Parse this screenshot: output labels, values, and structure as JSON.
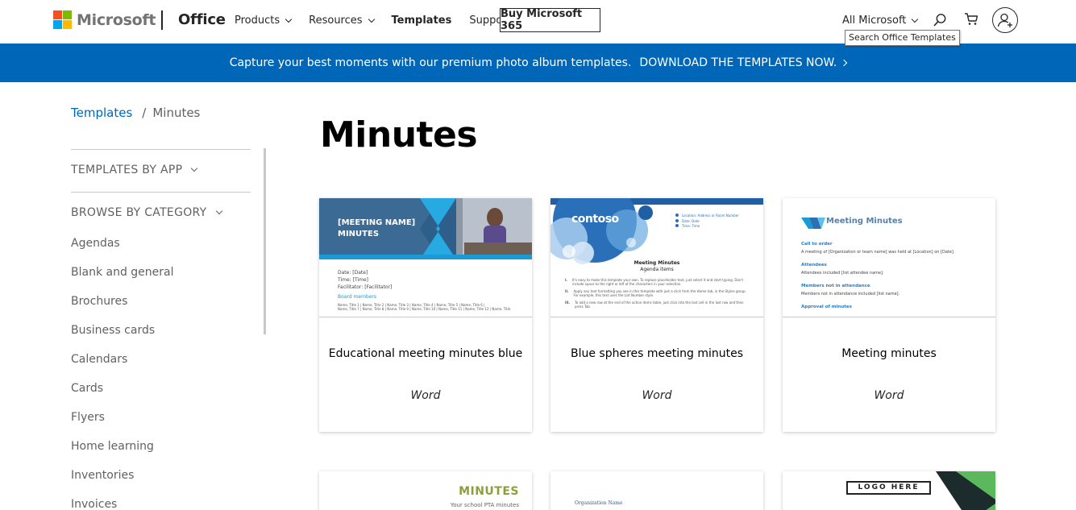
{
  "header": {
    "brand": "Microsoft",
    "product": "Office",
    "nav": [
      {
        "label": "Products",
        "has_dropdown": true
      },
      {
        "label": "Resources",
        "has_dropdown": true
      },
      {
        "label": "Templates",
        "has_dropdown": false
      },
      {
        "label": "Support",
        "has_dropdown": false
      }
    ],
    "buy_button": "Buy Microsoft 365",
    "all_microsoft": "All Microsoft",
    "search_tooltip": "Search Office Templates",
    "icons": [
      "search-icon",
      "cart-icon",
      "account-icon"
    ]
  },
  "banner": {
    "text": "Capture your best moments with our premium photo album templates.",
    "cta": "DOWNLOAD THE TEMPLATES NOW.",
    "background": "#0067b8"
  },
  "breadcrumb": {
    "root": "Templates",
    "separator": "/",
    "current": "Minutes"
  },
  "sidebar": {
    "templates_by_app": "TEMPLATES BY APP",
    "browse_by_category": "BROWSE BY CATEGORY",
    "categories": [
      "Agendas",
      "Blank and general",
      "Brochures",
      "Business cards",
      "Calendars",
      "Cards",
      "Flyers",
      "Home learning",
      "Inventories",
      "Invoices"
    ]
  },
  "main": {
    "title": "Minutes",
    "cards": [
      {
        "title": "Educational meeting minutes blue",
        "app": "Word",
        "preview": {
          "heading1": "[MEETING NAME]",
          "heading2": "MINUTES",
          "line1": "Date: [Date]",
          "line2": "Time: [Time]",
          "line3": "Facilitator: [Facilitator]",
          "section": "Board members",
          "detail1": "Name, Title 1 | Name, Title 2 | Name, Title 3 | Name, Title 4 | Name, Title 5 | Name, Title 6 |",
          "detail2": "Name, Title 7 | Name, Title 8 | Name, Title 9 | Name, Title 10 | Name, Title 11 | Name, Title 12 | Name, Title"
        }
      },
      {
        "title": "Blue spheres meeting minutes",
        "app": "Word",
        "preview": {
          "logo": "contoso",
          "meta1": "Location: Address or Room Number",
          "meta2": "Date: Date",
          "meta3": "Time: Time",
          "heading1": "Meeting Minutes",
          "heading2": "Agenda items",
          "item1": "It's easy to make this template your own. To replace placeholder text, just select it and start typing. Don't include space to the right or left of the characters in your selection.",
          "item2": "Apply any text formatting you see in this template with just a click from the Home tab, in the Styles group. For example, this text uses the List Number style.",
          "item3": "To add a new row at the end of the action items table, just click into the last cell in the last row and then press Tab."
        }
      },
      {
        "title": "Meeting minutes",
        "app": "Word",
        "preview": {
          "heading": "Meeting Minutes",
          "s1": "Call to order",
          "t1": "A meeting of [Organization or team name] was held at [Location] on [Date].",
          "s2": "Attendees",
          "t2": "Attendees included [list attendee name].",
          "s3": "Members not in attendance",
          "t3": "Members not in attendance included [list name].",
          "s4": "Approval of minutes"
        }
      }
    ],
    "row2": {
      "card1_title": "MINUTES",
      "card1_sub": "Your school PTA minutes",
      "card2_org": "Organization Name",
      "card3_logo": "LOGO HERE"
    }
  }
}
